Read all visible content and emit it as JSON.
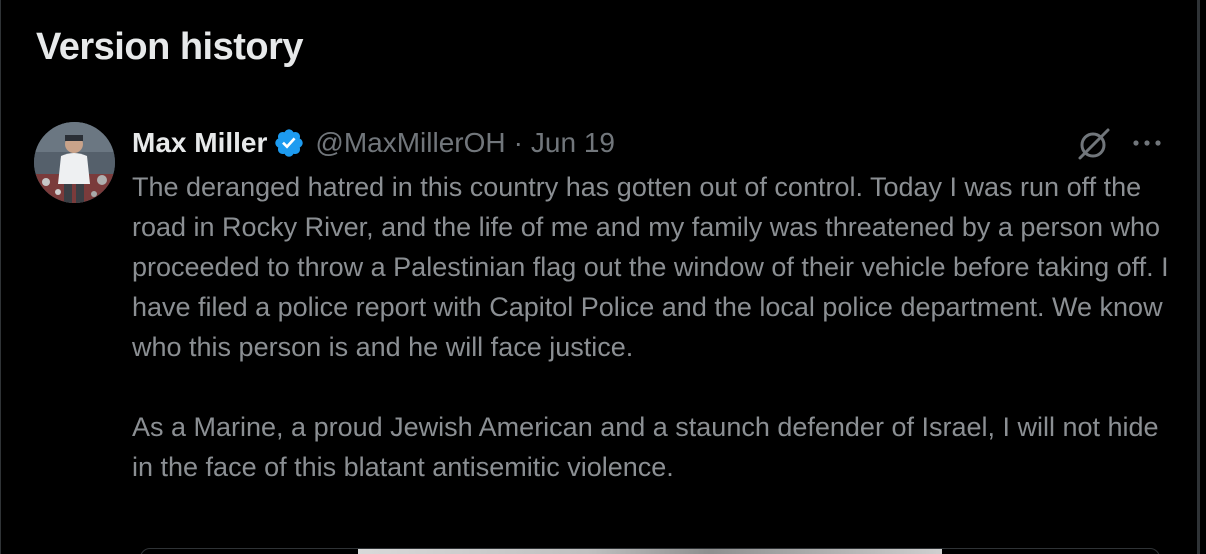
{
  "page": {
    "title": "Version history"
  },
  "tweet": {
    "author": {
      "display_name": "Max Miller",
      "handle": "@MaxMillerOH",
      "verified": true
    },
    "separator": "·",
    "date": "Jun 19",
    "paragraphs": [
      "The deranged hatred in this country has gotten out of control. Today I was run off the road in Rocky River, and the life of me and my family was threatened by a person who proceeded to throw a Palestinian flag out the window of their vehicle before taking off. I have filed a police report with Capitol Police and the local police department. We know who this person is and he will face justice.",
      "As a Marine, a proud Jewish American and a staunch defender of Israel, I will not hide in the face of this blatant antisemitic violence."
    ],
    "icons": {
      "verified": "verified-badge-icon",
      "grok": "grok-icon",
      "more": "more-options-icon"
    }
  },
  "colors": {
    "background": "#000000",
    "text_primary": "#e7e9ea",
    "text_secondary": "#71767b",
    "tweet_text": "#8b8f93",
    "verified_blue": "#1d9bf0",
    "border": "#2f3336"
  }
}
